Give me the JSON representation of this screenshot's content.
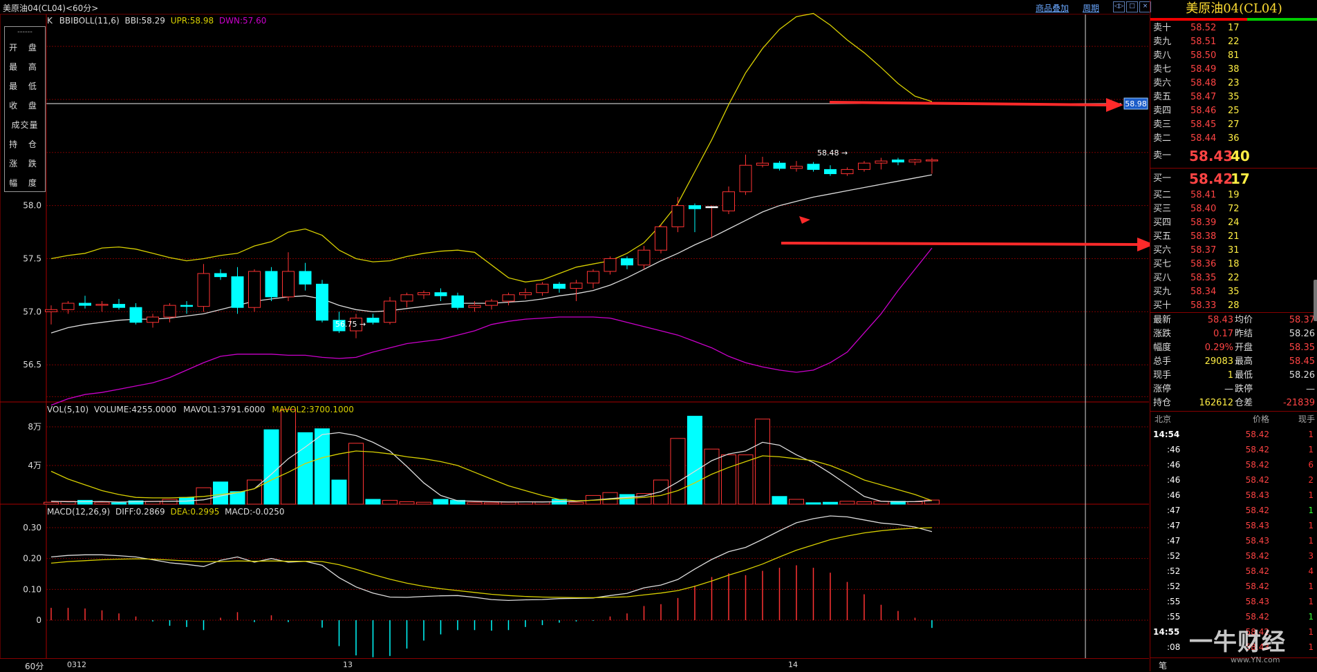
{
  "window": {
    "title": "美原油04(CL04)<60分>",
    "links": [
      "商品叠加",
      "周期"
    ]
  },
  "infobox": {
    "sep": "------",
    "rows": [
      "开 盘",
      "最 高",
      "最 低",
      "收 盘",
      "成交量",
      "持 仓",
      "涨 跌",
      "幅 度"
    ]
  },
  "legend": {
    "main": {
      "k": "K",
      "name": "BBIBOLL(11,6)",
      "bbi": "BBI:58.29",
      "upr": "UPR:58.98",
      "dwn": "DWN:57.60"
    },
    "vol": {
      "name": "VOL(5,10)",
      "volume": "VOLUME:4255.0000",
      "mavol1": "MAVOL1:3791.6000",
      "mavol2": "MAVOL2:3700.1000"
    },
    "macd": {
      "name": "MACD(12,26,9)",
      "diff": "DIFF:0.2869",
      "dea": "DEA:0.2995",
      "macd": "MACD:-0.0250"
    }
  },
  "axis": {
    "price_ticks": [
      "58.0",
      "57.5",
      "57.0",
      "56.5"
    ],
    "vol_ticks": [
      "8万",
      "4万"
    ],
    "macd_ticks": [
      "0.30",
      "0.20",
      "0.10",
      "0"
    ],
    "dates": [
      "0312",
      "13",
      "14"
    ],
    "period": "60分",
    "upr_tag": "58.98"
  },
  "annotations": {
    "high": "58.48",
    "low": "56.75"
  },
  "colors": {
    "up": "#ff3333",
    "down": "#00ffff",
    "upr": "#d8d000",
    "dwn": "#cc00cc",
    "bbi": "#dddddd",
    "grid": "#7a0000",
    "arrow": "#ff2a2a"
  },
  "chart_data": {
    "type": "candlestick",
    "y_range": [
      56.15,
      59.8
    ],
    "candles": [
      {
        "o": 57.0,
        "h": 57.06,
        "l": 56.88,
        "c": 57.02
      },
      {
        "o": 57.02,
        "h": 57.1,
        "l": 56.98,
        "c": 57.08
      },
      {
        "o": 57.08,
        "h": 57.15,
        "l": 57.03,
        "c": 57.06
      },
      {
        "o": 57.06,
        "h": 57.1,
        "l": 57.0,
        "c": 57.07
      },
      {
        "o": 57.07,
        "h": 57.12,
        "l": 57.02,
        "c": 57.04
      },
      {
        "o": 57.04,
        "h": 57.08,
        "l": 56.88,
        "c": 56.9
      },
      {
        "o": 56.9,
        "h": 56.98,
        "l": 56.85,
        "c": 56.95
      },
      {
        "o": 56.95,
        "h": 57.08,
        "l": 56.9,
        "c": 57.06
      },
      {
        "o": 57.06,
        "h": 57.1,
        "l": 56.98,
        "c": 57.05
      },
      {
        "o": 57.05,
        "h": 57.45,
        "l": 57.0,
        "c": 57.36
      },
      {
        "o": 57.36,
        "h": 57.4,
        "l": 57.3,
        "c": 57.33
      },
      {
        "o": 57.33,
        "h": 57.42,
        "l": 56.98,
        "c": 57.04
      },
      {
        "o": 57.04,
        "h": 57.4,
        "l": 57.0,
        "c": 57.38
      },
      {
        "o": 57.38,
        "h": 57.42,
        "l": 57.1,
        "c": 57.14
      },
      {
        "o": 57.14,
        "h": 57.56,
        "l": 57.1,
        "c": 57.38
      },
      {
        "o": 57.38,
        "h": 57.46,
        "l": 57.2,
        "c": 57.26
      },
      {
        "o": 57.26,
        "h": 57.3,
        "l": 56.9,
        "c": 56.92
      },
      {
        "o": 56.92,
        "h": 57.0,
        "l": 56.8,
        "c": 56.82
      },
      {
        "o": 56.82,
        "h": 56.98,
        "l": 56.75,
        "c": 56.94
      },
      {
        "o": 56.94,
        "h": 56.98,
        "l": 56.88,
        "c": 56.9
      },
      {
        "o": 56.9,
        "h": 57.14,
        "l": 56.88,
        "c": 57.1
      },
      {
        "o": 57.1,
        "h": 57.18,
        "l": 57.04,
        "c": 57.16
      },
      {
        "o": 57.16,
        "h": 57.2,
        "l": 57.12,
        "c": 57.18
      },
      {
        "o": 57.18,
        "h": 57.22,
        "l": 57.1,
        "c": 57.15
      },
      {
        "o": 57.15,
        "h": 57.18,
        "l": 57.02,
        "c": 57.04
      },
      {
        "o": 57.04,
        "h": 57.1,
        "l": 57.0,
        "c": 57.06
      },
      {
        "o": 57.06,
        "h": 57.12,
        "l": 57.02,
        "c": 57.1
      },
      {
        "o": 57.1,
        "h": 57.18,
        "l": 57.06,
        "c": 57.16
      },
      {
        "o": 57.16,
        "h": 57.22,
        "l": 57.12,
        "c": 57.18
      },
      {
        "o": 57.18,
        "h": 57.28,
        "l": 57.15,
        "c": 57.26
      },
      {
        "o": 57.26,
        "h": 57.28,
        "l": 57.18,
        "c": 57.22
      },
      {
        "o": 57.22,
        "h": 57.3,
        "l": 57.1,
        "c": 57.27
      },
      {
        "o": 57.27,
        "h": 57.4,
        "l": 57.22,
        "c": 57.38
      },
      {
        "o": 57.38,
        "h": 57.52,
        "l": 57.35,
        "c": 57.5
      },
      {
        "o": 57.5,
        "h": 57.52,
        "l": 57.4,
        "c": 57.44
      },
      {
        "o": 57.44,
        "h": 57.62,
        "l": 57.4,
        "c": 57.58
      },
      {
        "o": 57.58,
        "h": 57.82,
        "l": 57.55,
        "c": 57.8
      },
      {
        "o": 57.8,
        "h": 58.08,
        "l": 57.75,
        "c": 58.0
      },
      {
        "o": 58.0,
        "h": 58.02,
        "l": 57.75,
        "c": 57.97
      },
      {
        "o": 57.98,
        "h": 58.0,
        "l": 57.7,
        "c": 57.99
      },
      {
        "o": 57.95,
        "h": 58.18,
        "l": 57.92,
        "c": 58.13
      },
      {
        "o": 58.13,
        "h": 58.48,
        "l": 58.1,
        "c": 58.38
      },
      {
        "o": 58.38,
        "h": 58.46,
        "l": 58.36,
        "c": 58.4
      },
      {
        "o": 58.4,
        "h": 58.42,
        "l": 58.33,
        "c": 58.35
      },
      {
        "o": 58.35,
        "h": 58.42,
        "l": 58.32,
        "c": 58.37
      },
      {
        "o": 58.39,
        "h": 58.41,
        "l": 58.32,
        "c": 58.34
      },
      {
        "o": 58.34,
        "h": 58.38,
        "l": 58.28,
        "c": 58.3
      },
      {
        "o": 58.3,
        "h": 58.36,
        "l": 58.28,
        "c": 58.34
      },
      {
        "o": 58.34,
        "h": 58.42,
        "l": 58.32,
        "c": 58.4
      },
      {
        "o": 58.4,
        "h": 58.45,
        "l": 58.34,
        "c": 58.42
      },
      {
        "o": 58.43,
        "h": 58.45,
        "l": 58.38,
        "c": 58.41
      },
      {
        "o": 58.41,
        "h": 58.44,
        "l": 58.38,
        "c": 58.43
      },
      {
        "o": 58.42,
        "h": 58.45,
        "l": 58.3,
        "c": 58.43
      }
    ],
    "upr": [
      57.5,
      57.53,
      57.55,
      57.6,
      57.61,
      57.59,
      57.55,
      57.51,
      57.48,
      57.5,
      57.53,
      57.55,
      57.62,
      57.66,
      57.75,
      57.78,
      57.72,
      57.58,
      57.5,
      57.47,
      57.48,
      57.52,
      57.55,
      57.57,
      57.58,
      57.56,
      57.44,
      57.32,
      57.28,
      57.3,
      57.36,
      57.42,
      57.45,
      57.48,
      57.55,
      57.65,
      57.82,
      58.02,
      58.32,
      58.62,
      58.95,
      59.25,
      59.48,
      59.66,
      59.78,
      59.81,
      59.7,
      59.56,
      59.44,
      59.3,
      59.15,
      59.03,
      58.98
    ],
    "dwn": [
      56.12,
      56.18,
      56.22,
      56.24,
      56.27,
      56.3,
      56.33,
      56.38,
      56.45,
      56.52,
      56.58,
      56.6,
      56.6,
      56.6,
      56.59,
      56.59,
      56.57,
      56.56,
      56.57,
      56.62,
      56.66,
      56.7,
      56.72,
      56.74,
      56.78,
      56.82,
      56.88,
      56.91,
      56.93,
      56.94,
      56.95,
      56.95,
      56.95,
      56.94,
      56.9,
      56.86,
      56.82,
      56.78,
      56.72,
      56.66,
      56.58,
      56.52,
      56.48,
      56.45,
      56.43,
      56.45,
      56.52,
      56.62,
      56.8,
      56.98,
      57.2,
      57.4,
      57.6
    ],
    "bbi": [
      56.8,
      56.85,
      56.88,
      56.9,
      56.92,
      56.93,
      56.93,
      56.94,
      56.96,
      56.98,
      57.02,
      57.06,
      57.1,
      57.12,
      57.14,
      57.15,
      57.12,
      57.06,
      57.02,
      57.0,
      57.01,
      57.03,
      57.05,
      57.07,
      57.08,
      57.08,
      57.08,
      57.09,
      57.1,
      57.12,
      57.15,
      57.17,
      57.2,
      57.25,
      57.32,
      57.4,
      57.48,
      57.55,
      57.63,
      57.7,
      57.78,
      57.86,
      57.94,
      58.0,
      58.04,
      58.08,
      58.11,
      58.14,
      58.17,
      58.2,
      58.23,
      58.26,
      58.29
    ],
    "volume": [
      2000,
      3000,
      4000,
      2000,
      1500,
      3500,
      3000,
      5000,
      7000,
      17000,
      23000,
      13000,
      25000,
      77000,
      98000,
      74000,
      78000,
      25000,
      63000,
      5000,
      4000,
      2500,
      2000,
      5000,
      4000,
      2000,
      1500,
      2000,
      2500,
      2500,
      5000,
      2000,
      9000,
      12000,
      10000,
      11000,
      25000,
      68000,
      91000,
      57000,
      51000,
      51000,
      88000,
      8000,
      5000,
      1500,
      2000,
      3000,
      2500,
      3000,
      3000,
      2500,
      4255
    ],
    "mavol1": [
      3000,
      2500,
      2600,
      2800,
      2200,
      2600,
      2800,
      3000,
      3200,
      4500,
      8500,
      12000,
      16000,
      31000,
      47000,
      59000,
      72000,
      74000,
      71000,
      64000,
      55000,
      39000,
      22000,
      9000,
      3500,
      3100,
      2600,
      2300,
      2400,
      2300,
      2600,
      3000,
      4200,
      5800,
      7000,
      8500,
      13000,
      23000,
      34000,
      45000,
      52000,
      55000,
      64000,
      61000,
      51000,
      43000,
      32000,
      20000,
      8000,
      3000,
      2500,
      2700,
      3792
    ],
    "mavol2": [
      34000,
      26000,
      20000,
      14000,
      10000,
      7000,
      6500,
      6500,
      7000,
      8000,
      10000,
      12000,
      16000,
      25000,
      33000,
      42000,
      48000,
      52000,
      55000,
      54000,
      52000,
      49000,
      47000,
      44000,
      40000,
      33000,
      26000,
      19000,
      14000,
      9000,
      5000,
      3500,
      4000,
      5000,
      6000,
      7000,
      9000,
      14000,
      22000,
      31000,
      38000,
      44000,
      50000,
      49000,
      47000,
      45000,
      40000,
      33000,
      25000,
      20000,
      15000,
      10000,
      3700
    ],
    "diff": [
      0.205,
      0.21,
      0.212,
      0.212,
      0.209,
      0.205,
      0.196,
      0.186,
      0.181,
      0.174,
      0.194,
      0.205,
      0.188,
      0.2,
      0.188,
      0.191,
      0.178,
      0.138,
      0.108,
      0.088,
      0.075,
      0.074,
      0.077,
      0.079,
      0.08,
      0.074,
      0.067,
      0.064,
      0.066,
      0.067,
      0.07,
      0.071,
      0.072,
      0.08,
      0.087,
      0.105,
      0.114,
      0.132,
      0.166,
      0.197,
      0.222,
      0.236,
      0.262,
      0.29,
      0.316,
      0.329,
      0.338,
      0.335,
      0.325,
      0.315,
      0.31,
      0.302,
      0.287
    ],
    "dea": [
      0.185,
      0.19,
      0.193,
      0.196,
      0.198,
      0.199,
      0.198,
      0.195,
      0.192,
      0.19,
      0.19,
      0.192,
      0.191,
      0.192,
      0.191,
      0.191,
      0.19,
      0.18,
      0.165,
      0.148,
      0.133,
      0.12,
      0.11,
      0.102,
      0.096,
      0.09,
      0.084,
      0.08,
      0.077,
      0.075,
      0.074,
      0.073,
      0.073,
      0.074,
      0.076,
      0.082,
      0.088,
      0.096,
      0.11,
      0.127,
      0.146,
      0.163,
      0.182,
      0.205,
      0.227,
      0.244,
      0.261,
      0.273,
      0.283,
      0.29,
      0.295,
      0.298,
      0.3
    ],
    "macd": [
      0.04,
      0.04,
      0.038,
      0.032,
      0.022,
      0.012,
      -0.004,
      -0.018,
      -0.022,
      -0.032,
      0.008,
      0.026,
      -0.006,
      0.016,
      -0.006,
      0.0,
      -0.024,
      -0.084,
      -0.114,
      -0.12,
      -0.116,
      -0.092,
      -0.066,
      -0.046,
      -0.032,
      -0.032,
      -0.034,
      -0.032,
      -0.022,
      -0.016,
      -0.008,
      -0.004,
      -0.002,
      0.012,
      0.022,
      0.046,
      0.052,
      0.072,
      0.112,
      0.14,
      0.152,
      0.146,
      0.16,
      0.17,
      0.178,
      0.17,
      0.154,
      0.124,
      0.084,
      0.05,
      0.03,
      0.008,
      -0.025
    ]
  },
  "orderbook": {
    "title": "美原油04(CL04)",
    "sells": [
      {
        "label": "卖十",
        "price": "58.52",
        "vol": "17"
      },
      {
        "label": "卖九",
        "price": "58.51",
        "vol": "22"
      },
      {
        "label": "卖八",
        "price": "58.50",
        "vol": "81"
      },
      {
        "label": "卖七",
        "price": "58.49",
        "vol": "38"
      },
      {
        "label": "卖六",
        "price": "58.48",
        "vol": "23"
      },
      {
        "label": "卖五",
        "price": "58.47",
        "vol": "35"
      },
      {
        "label": "卖四",
        "price": "58.46",
        "vol": "25"
      },
      {
        "label": "卖三",
        "price": "58.45",
        "vol": "27"
      },
      {
        "label": "卖二",
        "price": "58.44",
        "vol": "36"
      },
      {
        "label": "卖一",
        "price": "58.43",
        "vol": "40"
      }
    ],
    "buys": [
      {
        "label": "买一",
        "price": "58.42",
        "vol": "17"
      },
      {
        "label": "买二",
        "price": "58.41",
        "vol": "19"
      },
      {
        "label": "买三",
        "price": "58.40",
        "vol": "72"
      },
      {
        "label": "买四",
        "price": "58.39",
        "vol": "24"
      },
      {
        "label": "买五",
        "price": "58.38",
        "vol": "21"
      },
      {
        "label": "买六",
        "price": "58.37",
        "vol": "31"
      },
      {
        "label": "买七",
        "price": "58.36",
        "vol": "18"
      },
      {
        "label": "买八",
        "price": "58.35",
        "vol": "22"
      },
      {
        "label": "买九",
        "price": "58.34",
        "vol": "35"
      },
      {
        "label": "买十",
        "price": "58.33",
        "vol": "28"
      }
    ]
  },
  "stats": [
    {
      "l": "最新",
      "v": "58.43",
      "r": "均价",
      "rv": "58.37"
    },
    {
      "l": "涨跌",
      "v": "0.17",
      "r": "昨结",
      "rv": "58.26"
    },
    {
      "l": "幅度",
      "v": "0.29%",
      "r": "开盘",
      "rv": "58.35"
    },
    {
      "l": "总手",
      "v": "29083",
      "r": "最高",
      "rv": "58.45"
    },
    {
      "l": "现手",
      "v": "1",
      "r": "最低",
      "rv": "58.26"
    },
    {
      "l": "涨停",
      "v": "—",
      "r": "跌停",
      "rv": "—"
    },
    {
      "l": "持仓",
      "v": "162612",
      "r": "仓差",
      "rv": "-21839"
    }
  ],
  "ticks": {
    "header": {
      "city": "北京",
      "price": "价格",
      "qty": "现手"
    },
    "rows": [
      {
        "t": "14:54",
        "p": "58.42",
        "q": "1",
        "qc": "#ff3333"
      },
      {
        "t": ":46",
        "p": "58.42",
        "q": "1",
        "qc": "#ff3333"
      },
      {
        "t": ":46",
        "p": "58.42",
        "q": "6",
        "qc": "#ff3333"
      },
      {
        "t": ":46",
        "p": "58.42",
        "q": "2",
        "qc": "#ff3333"
      },
      {
        "t": ":46",
        "p": "58.43",
        "q": "1",
        "qc": "#ff3333"
      },
      {
        "t": ":47",
        "p": "58.42",
        "q": "1",
        "qc": "#33ff33"
      },
      {
        "t": ":47",
        "p": "58.43",
        "q": "1",
        "qc": "#ff3333"
      },
      {
        "t": ":47",
        "p": "58.43",
        "q": "1",
        "qc": "#ff3333"
      },
      {
        "t": ":52",
        "p": "58.42",
        "q": "3",
        "qc": "#ff3333"
      },
      {
        "t": ":52",
        "p": "58.42",
        "q": "4",
        "qc": "#ff3333"
      },
      {
        "t": ":52",
        "p": "58.42",
        "q": "1",
        "qc": "#ff3333"
      },
      {
        "t": ":55",
        "p": "58.43",
        "q": "1",
        "qc": "#ff3333"
      },
      {
        "t": ":55",
        "p": "58.42",
        "q": "1",
        "qc": "#33ff33"
      },
      {
        "t": "14:55",
        "p": "58.42",
        "q": "1",
        "qc": "#ff3333"
      },
      {
        "t": ":08",
        "p": "58.43",
        "q": "1",
        "qc": "#ff3333"
      }
    ]
  },
  "bottom": {
    "label": "笔"
  },
  "watermark": {
    "brand": "一牛财经",
    "url": "www.YN.com"
  }
}
